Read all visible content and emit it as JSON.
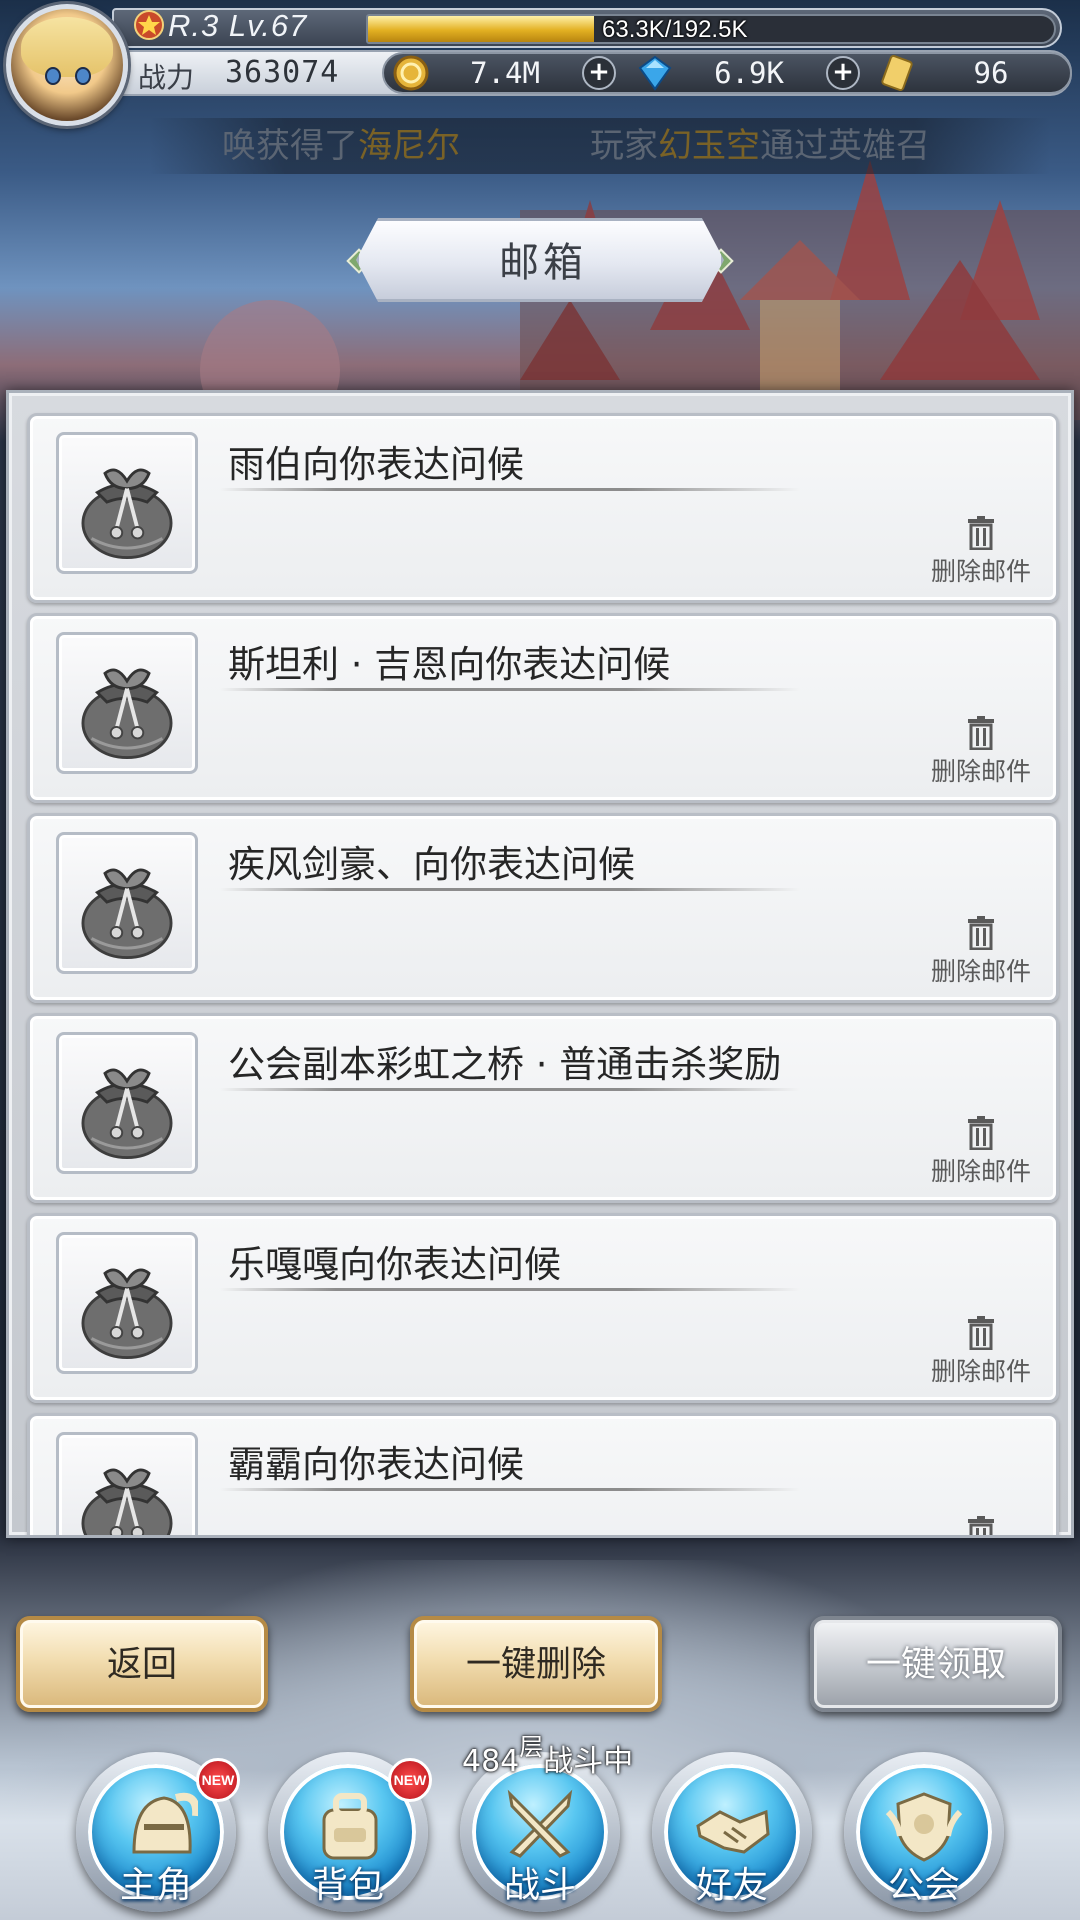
{
  "player": {
    "rank_level": "R.3 Lv.67",
    "exp_text": "63.3K/192.5K",
    "exp_fraction": 0.329,
    "power_label": "战力",
    "power_value": "363074"
  },
  "resources": [
    {
      "icon": "gold-coin-icon",
      "value": "7.4M"
    },
    {
      "icon": "blue-diamond-icon",
      "value": "6.9K"
    },
    {
      "icon": "gold-ticket-icon",
      "value": "96"
    }
  ],
  "marquee": {
    "part1": "唤获得了",
    "hero": "海尼尔",
    "part2": "玩家",
    "player": "幻玉空",
    "part3": "通过英雄召"
  },
  "title": "邮箱",
  "mail_delete_label": "删除邮件",
  "mails": [
    {
      "title": "雨伯向你表达问候"
    },
    {
      "title": "斯坦利 · 吉恩向你表达问候"
    },
    {
      "title": "疾风剑豪、向你表达问候"
    },
    {
      "title": "公会副本彩虹之桥 · 普通击杀奖励"
    },
    {
      "title": "乐嘎嘎向你表达问候"
    },
    {
      "title": "霸霸向你表达问候"
    }
  ],
  "buttons": {
    "back": "返回",
    "delete_all": "一键删除",
    "claim_all": "一键领取"
  },
  "battle_status": {
    "floor": "484",
    "floor_unit": "层",
    "state": "战斗中"
  },
  "nav": [
    {
      "label": "主角",
      "icon": "knight-helmet-icon",
      "badge": "NEW"
    },
    {
      "label": "背包",
      "icon": "backpack-icon",
      "badge": "NEW"
    },
    {
      "label": "战斗",
      "icon": "crossed-swords-icon",
      "badge": ""
    },
    {
      "label": "好友",
      "icon": "handshake-icon",
      "badge": ""
    },
    {
      "label": "公会",
      "icon": "guild-crest-icon",
      "badge": ""
    }
  ],
  "colors": {
    "exp_fill": "#e2b022",
    "nav_orb": "#1e8fd2",
    "new_badge": "#d91f28",
    "button_gold": "#f2ddb0",
    "button_gray": "#c7cbd1"
  }
}
